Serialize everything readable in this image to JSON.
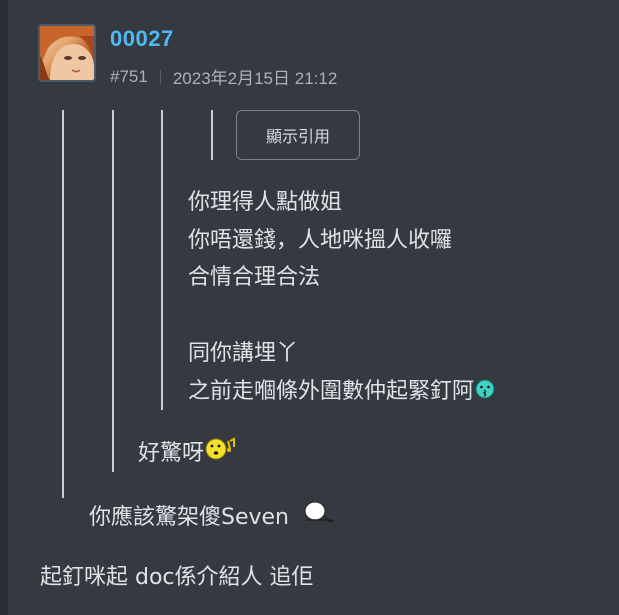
{
  "post": {
    "username": "00027",
    "number": "#751",
    "timestamp": "2023年2月15日 21:12"
  },
  "quote_button": {
    "label": "顯示引用"
  },
  "quote_level3": {
    "lines": [
      "你理得人點做姐",
      "你唔還錢，人地咪搵人收囉",
      "合情合理合法",
      "",
      "同你講埋丫",
      "之前走嗰條外圍數仲起緊釘阿"
    ]
  },
  "quote_level2": {
    "text": "好驚呀"
  },
  "quote_level1": {
    "text": "你應該驚架傻Seven"
  },
  "reply": {
    "text": "起釘咪起 doc係介紹人 追佢"
  },
  "colors": {
    "background": "#353a41",
    "username": "#4fb9f2",
    "meta": "#aab1ba",
    "quote_bar": "#c9ced4"
  }
}
